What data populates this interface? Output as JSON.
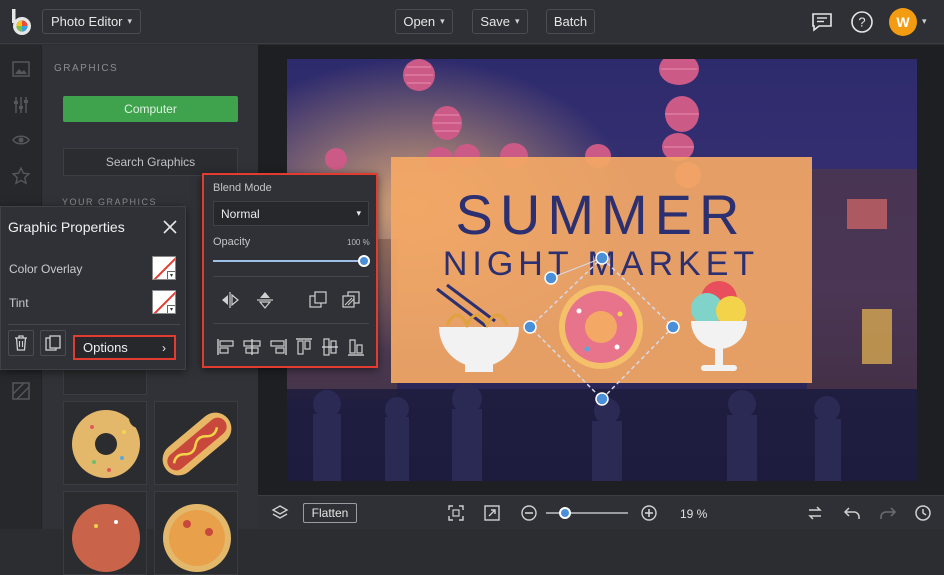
{
  "topbar": {
    "app_name": "Photo Editor",
    "menu": [
      {
        "label": "Open"
      },
      {
        "label": "Save"
      },
      {
        "label": "Batch"
      }
    ],
    "user_initial": "W",
    "accent_color": "#f39c12"
  },
  "graphics_panel": {
    "title": "GRAPHICS",
    "computer_label": "Computer",
    "search_label": "Search Graphics",
    "your_graphics_title": "YOUR GRAPHICS",
    "computer_color": "#3fa34d"
  },
  "graphic_properties": {
    "title": "Graphic Properties",
    "color_overlay_label": "Color Overlay",
    "tint_label": "Tint",
    "options_label": "Options"
  },
  "blend_panel": {
    "blend_mode_label": "Blend Mode",
    "blend_mode_value": "Normal",
    "opacity_label": "Opacity",
    "opacity_value_text": "100 %",
    "opacity": 1.0,
    "highlight_color": "#e23b2f"
  },
  "canvas": {
    "headline_1": "SUMMER",
    "headline_2": "NIGHT MARKET",
    "banner_color": "#f3a865",
    "text_color": "#2c2f70"
  },
  "bottombar": {
    "flatten_label": "Flatten",
    "zoom_text": "19 %",
    "zoom_fraction": 0.19
  }
}
